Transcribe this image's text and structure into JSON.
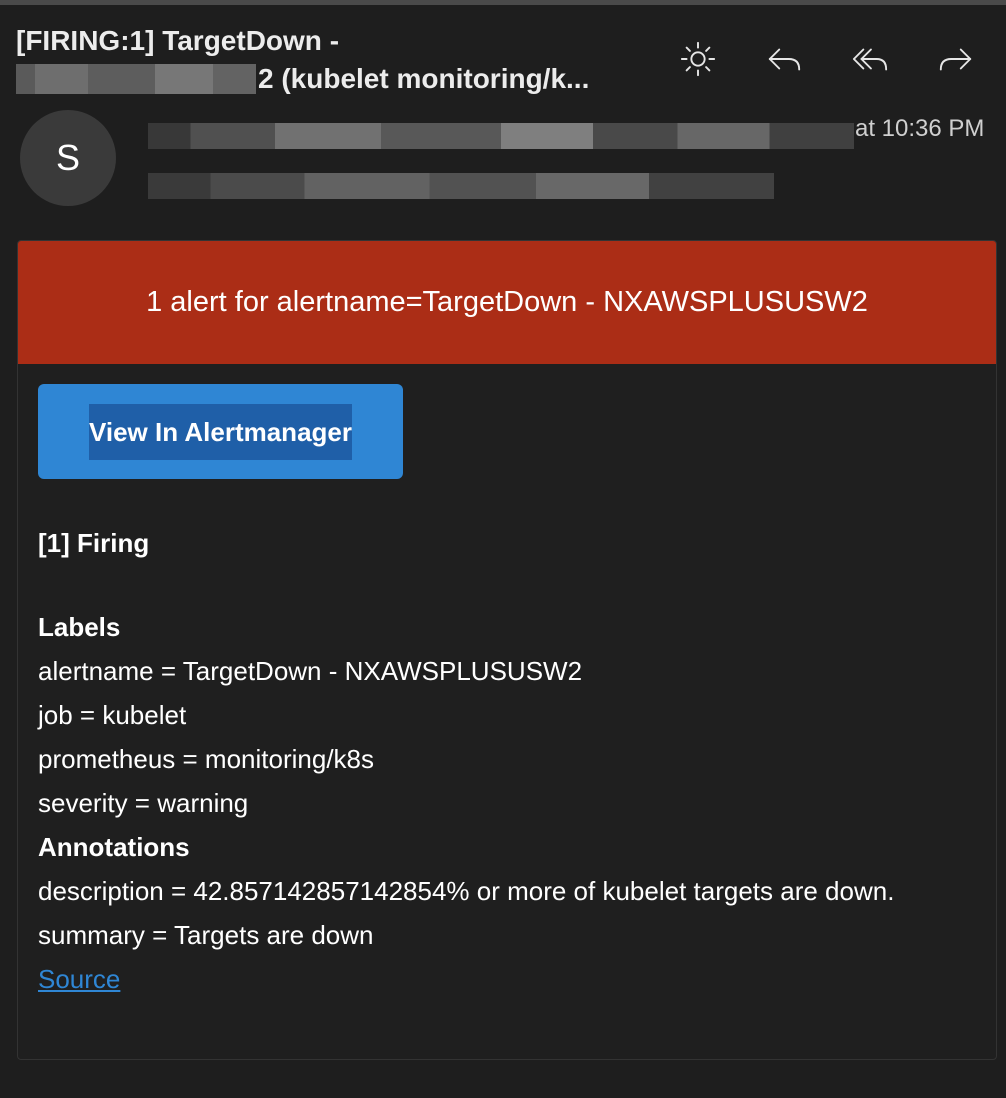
{
  "email": {
    "subject_line1": "[FIRING:1] TargetDown -",
    "subject_line2": "2 (kubelet monitoring/k...",
    "avatar_initial": "S",
    "timestamp": "at 10:36 PM"
  },
  "toolbar": {
    "icons": [
      "brightness-icon",
      "reply-icon",
      "reply-all-icon",
      "forward-icon"
    ]
  },
  "alert": {
    "header": "1 alert for alertname=TargetDown - NXAWSPLUSUSW2",
    "button_label": "View In Alertmanager",
    "firing_title": "[1] Firing",
    "labels_heading": "Labels",
    "labels": [
      "alertname = TargetDown - NXAWSPLUSUSW2",
      "job = kubelet",
      "prometheus = monitoring/k8s",
      "severity = warning"
    ],
    "annotations_heading": "Annotations",
    "annotations": [
      "description = 42.857142857142854% or more of kubelet targets are down.",
      "summary = Targets are down"
    ],
    "source_link": "Source"
  },
  "colors": {
    "background": "#1e1e1e",
    "alert_header": "#ab2d16",
    "button": "#2f86d4",
    "link": "#2f86d4"
  }
}
